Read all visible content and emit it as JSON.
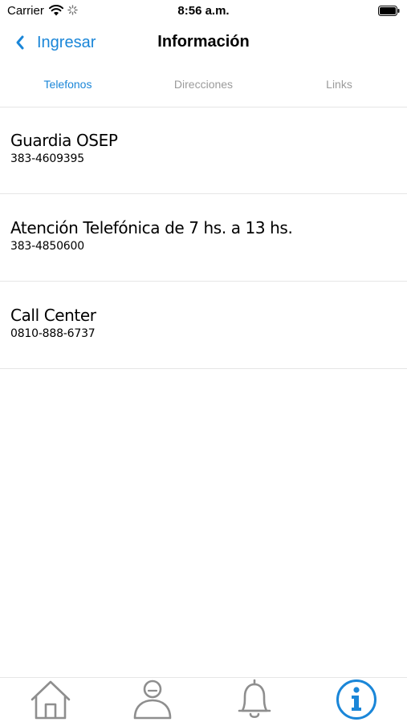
{
  "status_bar": {
    "carrier": "Carrier",
    "time": "8:56 a.m."
  },
  "nav": {
    "back_label": "Ingresar",
    "title": "Información"
  },
  "tabs": [
    {
      "label": "Telefonos",
      "active": true
    },
    {
      "label": "Direcciones",
      "active": false
    },
    {
      "label": "Links",
      "active": false
    }
  ],
  "contacts": [
    {
      "title": "Guardia OSEP",
      "phone": "383-4609395"
    },
    {
      "title": "Atención Telefónica de 7 hs. a 13 hs.",
      "phone": "383-4850600"
    },
    {
      "title": "Call Center",
      "phone": "0810-888-6737"
    }
  ],
  "bottom_tabs": [
    {
      "icon": "home-icon",
      "active": false
    },
    {
      "icon": "user-icon",
      "active": false
    },
    {
      "icon": "bell-icon",
      "active": false
    },
    {
      "icon": "info-icon",
      "active": true
    }
  ],
  "colors": {
    "accent": "#1a86d8",
    "inactive_tab_text": "#9b9b9b",
    "inactive_icon": "#8e8e8e",
    "divider": "#e6e6e6"
  }
}
